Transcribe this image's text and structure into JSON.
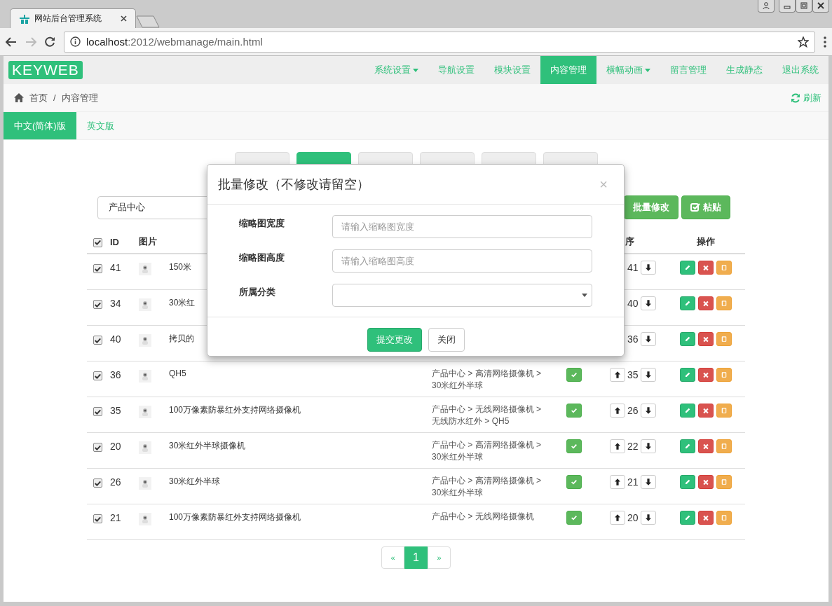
{
  "browser": {
    "tab_title": "网站后台管理系统",
    "url_host": "localhost",
    "url_path": ":2012/webmanage/main.html"
  },
  "navbar": {
    "logo": "KEYWEB",
    "items": [
      {
        "label": "系统设置",
        "dropdown": true,
        "selected": false
      },
      {
        "label": "导航设置",
        "dropdown": false,
        "selected": false
      },
      {
        "label": "模块设置",
        "dropdown": false,
        "selected": false
      },
      {
        "label": "内容管理",
        "dropdown": false,
        "selected": true
      },
      {
        "label": "横幅动画",
        "dropdown": true,
        "selected": false
      },
      {
        "label": "留言管理",
        "dropdown": false,
        "selected": false
      },
      {
        "label": "生成静态",
        "dropdown": false,
        "selected": false
      },
      {
        "label": "退出系统",
        "dropdown": false,
        "selected": false
      }
    ]
  },
  "breadcrumb": {
    "items": [
      "首页",
      "内容管理"
    ],
    "separator": "/",
    "refresh": "刷新"
  },
  "language_tabs": [
    {
      "label": "中文(简体)版",
      "selected": true
    },
    {
      "label": "英文版",
      "selected": false
    }
  ],
  "toolbar_tabs": [
    {
      "selected": false
    },
    {
      "selected": true
    },
    {
      "selected": false
    },
    {
      "selected": false
    },
    {
      "selected": false
    },
    {
      "selected": false
    }
  ],
  "filter": {
    "category": "产品中心"
  },
  "actions": [
    {
      "label": "批量修改",
      "kind": "batch"
    },
    {
      "label": "粘贴",
      "kind": "paste"
    }
  ],
  "table": {
    "select_all": true,
    "columns": {
      "id": "ID",
      "image": "图片",
      "sort": "序",
      "actions": "操作"
    },
    "rows": [
      {
        "selected": true,
        "id": "41",
        "title": "150米",
        "sort": "41"
      },
      {
        "selected": true,
        "id": "34",
        "title": "30米红",
        "sort": "40"
      },
      {
        "selected": true,
        "id": "40",
        "title": "拷贝的",
        "sort": "36"
      },
      {
        "selected": true,
        "id": "36",
        "title": "QH5",
        "category": [
          "产品中心 > 高清网络摄像机 >",
          "30米红外半球"
        ],
        "enabled": true,
        "sort": "35"
      },
      {
        "selected": true,
        "id": "35",
        "title": "100万像素防暴红外支持网络摄像机",
        "category": [
          "产品中心 > 无线网络摄像机 >",
          "无线防水红外 > QH5"
        ],
        "enabled": true,
        "sort": "26"
      },
      {
        "selected": true,
        "id": "20",
        "title": "30米红外半球摄像机",
        "category": [
          "产品中心 > 高清网络摄像机 >",
          "30米红外半球"
        ],
        "enabled": true,
        "sort": "22"
      },
      {
        "selected": true,
        "id": "26",
        "title": "30米红外半球",
        "category": [
          "产品中心 > 高清网络摄像机 >",
          "30米红外半球"
        ],
        "enabled": true,
        "sort": "21"
      },
      {
        "selected": true,
        "id": "21",
        "title": "100万像素防暴红外支持网络摄像机",
        "category": [
          "产品中心 > 无线网络摄像机"
        ],
        "enabled": true,
        "sort": "20"
      }
    ]
  },
  "pagination": [
    {
      "label": "«",
      "selected": false
    },
    {
      "label": "1",
      "selected": true
    },
    {
      "label": "»",
      "selected": false
    }
  ],
  "modal": {
    "title": "批量修改（不修改请留空）",
    "close": "×",
    "fields": [
      {
        "label": "缩略图宽度",
        "kind": "input",
        "placeholder": "请输入缩略图宽度"
      },
      {
        "label": "缩略图高度",
        "kind": "input",
        "placeholder": "请输入缩略图高度"
      },
      {
        "label": "所属分类",
        "kind": "select"
      }
    ],
    "buttons": [
      {
        "label": "提交更改",
        "kind": "primary"
      },
      {
        "label": "关闭",
        "kind": "default"
      }
    ]
  }
}
